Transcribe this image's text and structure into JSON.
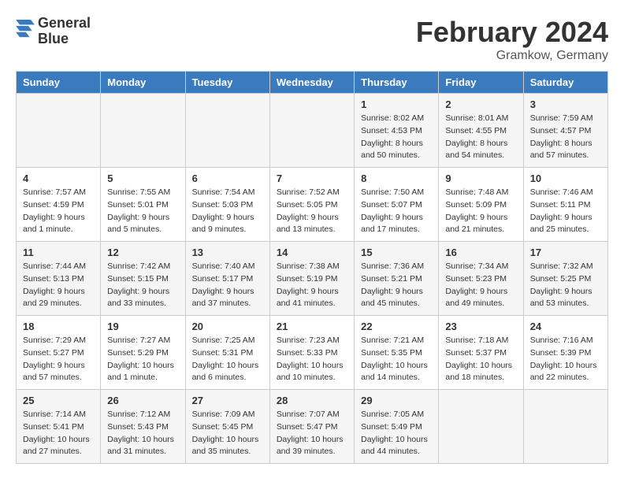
{
  "header": {
    "logo_line1": "General",
    "logo_line2": "Blue",
    "month_year": "February 2024",
    "location": "Gramkow, Germany"
  },
  "days_of_week": [
    "Sunday",
    "Monday",
    "Tuesday",
    "Wednesday",
    "Thursday",
    "Friday",
    "Saturday"
  ],
  "weeks": [
    [
      {
        "day": "",
        "info": ""
      },
      {
        "day": "",
        "info": ""
      },
      {
        "day": "",
        "info": ""
      },
      {
        "day": "",
        "info": ""
      },
      {
        "day": "1",
        "info": "Sunrise: 8:02 AM\nSunset: 4:53 PM\nDaylight: 8 hours\nand 50 minutes."
      },
      {
        "day": "2",
        "info": "Sunrise: 8:01 AM\nSunset: 4:55 PM\nDaylight: 8 hours\nand 54 minutes."
      },
      {
        "day": "3",
        "info": "Sunrise: 7:59 AM\nSunset: 4:57 PM\nDaylight: 8 hours\nand 57 minutes."
      }
    ],
    [
      {
        "day": "4",
        "info": "Sunrise: 7:57 AM\nSunset: 4:59 PM\nDaylight: 9 hours\nand 1 minute."
      },
      {
        "day": "5",
        "info": "Sunrise: 7:55 AM\nSunset: 5:01 PM\nDaylight: 9 hours\nand 5 minutes."
      },
      {
        "day": "6",
        "info": "Sunrise: 7:54 AM\nSunset: 5:03 PM\nDaylight: 9 hours\nand 9 minutes."
      },
      {
        "day": "7",
        "info": "Sunrise: 7:52 AM\nSunset: 5:05 PM\nDaylight: 9 hours\nand 13 minutes."
      },
      {
        "day": "8",
        "info": "Sunrise: 7:50 AM\nSunset: 5:07 PM\nDaylight: 9 hours\nand 17 minutes."
      },
      {
        "day": "9",
        "info": "Sunrise: 7:48 AM\nSunset: 5:09 PM\nDaylight: 9 hours\nand 21 minutes."
      },
      {
        "day": "10",
        "info": "Sunrise: 7:46 AM\nSunset: 5:11 PM\nDaylight: 9 hours\nand 25 minutes."
      }
    ],
    [
      {
        "day": "11",
        "info": "Sunrise: 7:44 AM\nSunset: 5:13 PM\nDaylight: 9 hours\nand 29 minutes."
      },
      {
        "day": "12",
        "info": "Sunrise: 7:42 AM\nSunset: 5:15 PM\nDaylight: 9 hours\nand 33 minutes."
      },
      {
        "day": "13",
        "info": "Sunrise: 7:40 AM\nSunset: 5:17 PM\nDaylight: 9 hours\nand 37 minutes."
      },
      {
        "day": "14",
        "info": "Sunrise: 7:38 AM\nSunset: 5:19 PM\nDaylight: 9 hours\nand 41 minutes."
      },
      {
        "day": "15",
        "info": "Sunrise: 7:36 AM\nSunset: 5:21 PM\nDaylight: 9 hours\nand 45 minutes."
      },
      {
        "day": "16",
        "info": "Sunrise: 7:34 AM\nSunset: 5:23 PM\nDaylight: 9 hours\nand 49 minutes."
      },
      {
        "day": "17",
        "info": "Sunrise: 7:32 AM\nSunset: 5:25 PM\nDaylight: 9 hours\nand 53 minutes."
      }
    ],
    [
      {
        "day": "18",
        "info": "Sunrise: 7:29 AM\nSunset: 5:27 PM\nDaylight: 9 hours\nand 57 minutes."
      },
      {
        "day": "19",
        "info": "Sunrise: 7:27 AM\nSunset: 5:29 PM\nDaylight: 10 hours\nand 1 minute."
      },
      {
        "day": "20",
        "info": "Sunrise: 7:25 AM\nSunset: 5:31 PM\nDaylight: 10 hours\nand 6 minutes."
      },
      {
        "day": "21",
        "info": "Sunrise: 7:23 AM\nSunset: 5:33 PM\nDaylight: 10 hours\nand 10 minutes."
      },
      {
        "day": "22",
        "info": "Sunrise: 7:21 AM\nSunset: 5:35 PM\nDaylight: 10 hours\nand 14 minutes."
      },
      {
        "day": "23",
        "info": "Sunrise: 7:18 AM\nSunset: 5:37 PM\nDaylight: 10 hours\nand 18 minutes."
      },
      {
        "day": "24",
        "info": "Sunrise: 7:16 AM\nSunset: 5:39 PM\nDaylight: 10 hours\nand 22 minutes."
      }
    ],
    [
      {
        "day": "25",
        "info": "Sunrise: 7:14 AM\nSunset: 5:41 PM\nDaylight: 10 hours\nand 27 minutes."
      },
      {
        "day": "26",
        "info": "Sunrise: 7:12 AM\nSunset: 5:43 PM\nDaylight: 10 hours\nand 31 minutes."
      },
      {
        "day": "27",
        "info": "Sunrise: 7:09 AM\nSunset: 5:45 PM\nDaylight: 10 hours\nand 35 minutes."
      },
      {
        "day": "28",
        "info": "Sunrise: 7:07 AM\nSunset: 5:47 PM\nDaylight: 10 hours\nand 39 minutes."
      },
      {
        "day": "29",
        "info": "Sunrise: 7:05 AM\nSunset: 5:49 PM\nDaylight: 10 hours\nand 44 minutes."
      },
      {
        "day": "",
        "info": ""
      },
      {
        "day": "",
        "info": ""
      }
    ]
  ]
}
